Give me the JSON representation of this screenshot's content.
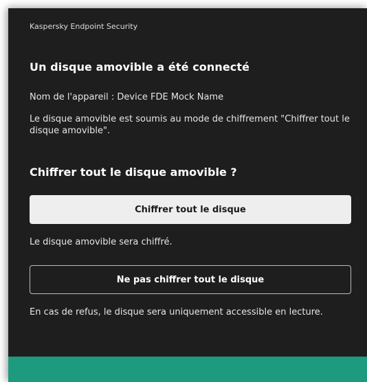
{
  "window": {
    "app_title": "Kaspersky Endpoint Security"
  },
  "dialog": {
    "heading": "Un disque amovible a été connecté",
    "device_name": "Nom de l'appareil : Device FDE Mock Name",
    "mode_text": "Le disque amovible est soumis au mode de chiffrement \"Chiffrer tout le disque amovible\".",
    "question": "Chiffrer tout le disque amovible ?",
    "encrypt_button_label": "Chiffrer tout le disque",
    "encrypt_description": "Le disque amovible sera chiffré.",
    "decline_button_label": "Ne pas chiffrer tout le disque",
    "decline_description": "En cas de refus, le disque sera uniquement accessible en lecture."
  },
  "colors": {
    "background": "#1e1e1e",
    "accent_footer": "#1e9a7f",
    "primary_button_bg": "#eeeeee",
    "secondary_button_border": "#bdbdbd"
  }
}
